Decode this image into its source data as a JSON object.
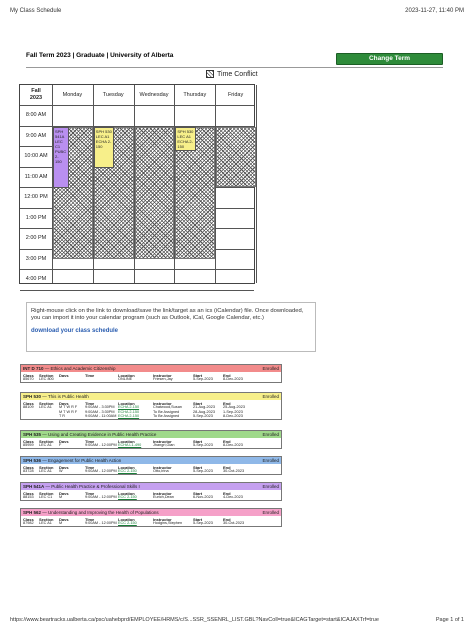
{
  "print_header": {
    "title": "My Class Schedule",
    "datetime": "2023-11-27, 11:40 PM"
  },
  "term": {
    "title": "Fall Term 2023 | Graduate | University of Alberta",
    "change_term_label": "Change Term"
  },
  "legend": {
    "time_conflict": "Time Conflict"
  },
  "grid": {
    "term_label": "Fall\n2023",
    "days": [
      "Monday",
      "Tuesday",
      "Wednesday",
      "Thursday",
      "Friday"
    ],
    "times": [
      "8:00 AM",
      "9:00 AM",
      "10:00 AM",
      "11:00 AM",
      "12:00 PM",
      "1:00 PM",
      "2:00 PM",
      "3:00 PM",
      "4:00 PM"
    ],
    "blocks": [
      {
        "day": "Monday",
        "text": "SPH 541A\nLEC C1\nPUBC 2-\n150",
        "color": "#b98ff0"
      },
      {
        "day": "Tuesday",
        "text": "SPH 530\nLEC A1\nECHA 2-\n150",
        "color": "#f7ef8a"
      },
      {
        "day": "Thursday",
        "text": "SPH 530\nLEC A1\nECHA 2-\n150",
        "color": "#f7ef8a"
      }
    ],
    "hatch_color": "#555555"
  },
  "info": {
    "text": "Right-mouse click on the link to download/save the link/target as an ics (iCalendar) file. Once downloaded, you can import it into your calendar program (such as Outlook, iCal, Google Calendar, etc.)",
    "link": "download your class schedule"
  },
  "course_columns": [
    "Class",
    "Section",
    "Days",
    "Time",
    "Location",
    "Instructor",
    "Start",
    "End"
  ],
  "courses": [
    {
      "code": "INT D 710",
      "title": "Ethics and Academic Citizenship",
      "status": "Enrolled",
      "color": "#f28b8b",
      "rows": [
        [
          "85670",
          "LEC 800",
          "",
          "",
          "ONLINE",
          "Friesen,Jay",
          "5-Sep-2023",
          "8-Dec-2023"
        ]
      ]
    },
    {
      "code": "SPH 530",
      "title": "This is Public Health",
      "status": "Enrolled",
      "color": "#f7ef8a",
      "rows": [
        [
          "88109",
          "LEC A1",
          "M T W R F",
          "9:00AM - 3:30PM",
          "ECHA 2-150",
          "Chatwood,Susan",
          "21-Aug-2023",
          "25-Aug-2023"
        ],
        [
          "",
          "",
          "M T W R F",
          "9:00AM - 3:30PM",
          "ECHA 2-150",
          "To Be Assigned",
          "28-Aug-2023",
          "1-Sep-2023"
        ],
        [
          "",
          "",
          "T R",
          "9:00AM - 11:00AM",
          "ECHA 2-150",
          "To Be Assigned",
          "5-Sep-2023",
          "8-Dec-2023"
        ]
      ]
    },
    {
      "code": "SPH 535",
      "title": "Using and Creating Evidence in Public Health Practice",
      "status": "Enrolled",
      "color": "#9fd98a",
      "rows": [
        [
          "85959",
          "LEC A1",
          "F",
          "9:00AM - 12:00PM",
          "ECHA L1-490",
          "Jhangri,Gian",
          "5-Sep-2023",
          "8-Dec-2023"
        ]
      ]
    },
    {
      "code": "SPH 536",
      "title": "Engagement for Public Health Action",
      "status": "Enrolled",
      "color": "#8fb8e8",
      "rows": [
        [
          "83728",
          "LEC A1",
          "W",
          "9:00AM - 12:00PM",
          "ECC 2-150",
          "Otto,Irina",
          "5-Sep-2023",
          "30-Oct-2023"
        ]
      ]
    },
    {
      "code": "SPH 541A",
      "title": "Public Health Practice & Professional Skills I",
      "status": "Enrolled",
      "color": "#c5a0f0",
      "rows": [
        [
          "88153",
          "LEC C1",
          "M",
          "9:00AM - 12:00PM",
          "ECC 2-150",
          "Eurich,Dean",
          "6-Nov-2023",
          "4-Dec-2023"
        ]
      ]
    },
    {
      "code": "SPH 562",
      "title": "Understanding and Improving the Health of Populations",
      "status": "Enrolled",
      "color": "#f5a0c8",
      "rows": [
        [
          "87982",
          "LEC A1",
          "M",
          "9:00AM - 12:00PM",
          "ECC 2-150",
          "Hodgins,Stephen",
          "5-Sep-2023",
          "30-Oct-2023"
        ]
      ]
    }
  ],
  "print_footer": {
    "url": "https://www.beartracks.ualberta.ca/psc/uahebprd/EMPLOYEE/HRMS/c/S...SSR_SSENRL_LIST.GBL?NavColl=true&ICAGTarget=start&ICAJAXTrf=true",
    "page": "Page 1 of 1"
  }
}
